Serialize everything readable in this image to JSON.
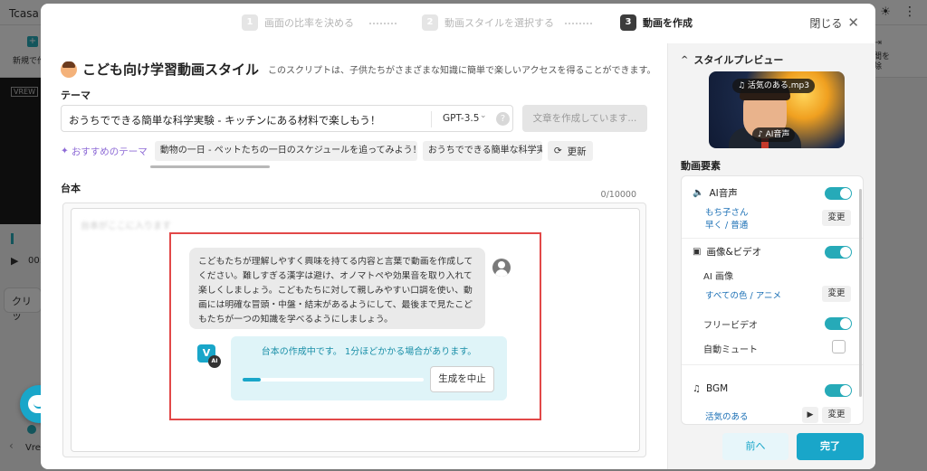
{
  "background": {
    "app_title": "Tcasa",
    "new_label": "新規で作",
    "right_label": "区間を削除",
    "video_tag": "VREW",
    "time": "00:",
    "clip_label": "クリッ",
    "bottom_label": "Vre"
  },
  "steps": [
    {
      "num": "1",
      "label": "画面の比率を決める"
    },
    {
      "num": "2",
      "label": "動画スタイルを選択する"
    },
    {
      "num": "3",
      "label": "動画を作成"
    }
  ],
  "close_label": "閉じる",
  "title": "こども向け学習動画スタイル",
  "title_desc": "このスクリプトは、子供たちがさまざまな知識に簡単で楽しいアクセスを得ることができます。",
  "theme": {
    "label": "テーマ",
    "value": "おうちでできる簡単な科学実験 - キッチンにある材料で楽しもう！",
    "model": "GPT-3.5",
    "help": "?",
    "generate_label": "文章を作成しています..."
  },
  "recommend": {
    "label": "おすすめのテーマ",
    "chips": [
      "動物の一日 - ペットたちの一日のスケジュールを追ってみよう！",
      "おうちでできる簡単な科学実験"
    ],
    "refresh_label": "更新"
  },
  "script": {
    "label": "台本",
    "count": "0/10000",
    "placeholder": "台本がここに入ります",
    "prompt": "こどもたちが理解しやすく興味を持てる内容と言葉で動画を作成してください。難しすぎる漢字は避け、オノマトペや効果音を取り入れて楽しくしましょう。こどもたちに対して親しみやすい口調を使い、動画には明確な冒頭・中盤・結末があるようにして、最後まで見たこどもたちが一つの知識を学べるようにしましょう。",
    "ai_icon": "V",
    "ai_badge": "AI",
    "status": "台本の作成中です。 1分ほどかかる場合があります。",
    "progress": 0.1,
    "stop_label": "生成を中止"
  },
  "preview": {
    "label": "スタイルプレビュー",
    "audio_chip": "♫ 活気のある.mp3",
    "voice_chip": "♪ AI音声"
  },
  "elements": {
    "label": "動画要素",
    "ai_voice": {
      "title": "AI音声",
      "voice": "もち子さん",
      "speed": "早く / 普通",
      "change": "変更",
      "on": true
    },
    "media": {
      "title": "画像&ビデオ",
      "ai_image": "AI 画像",
      "style": "すべての色 / アニメ",
      "change": "変更",
      "free_video": "フリービデオ",
      "auto_mute": "自動ミュート",
      "on": true
    },
    "bgm": {
      "title": "BGM",
      "mood": "活気のある",
      "change": "変更",
      "on": true
    }
  },
  "buttons": {
    "prev": "前へ",
    "done": "完了"
  },
  "colors": {
    "accent": "#19a6c9",
    "highlight": "#e24848",
    "recommend": "#8e6bd6"
  }
}
